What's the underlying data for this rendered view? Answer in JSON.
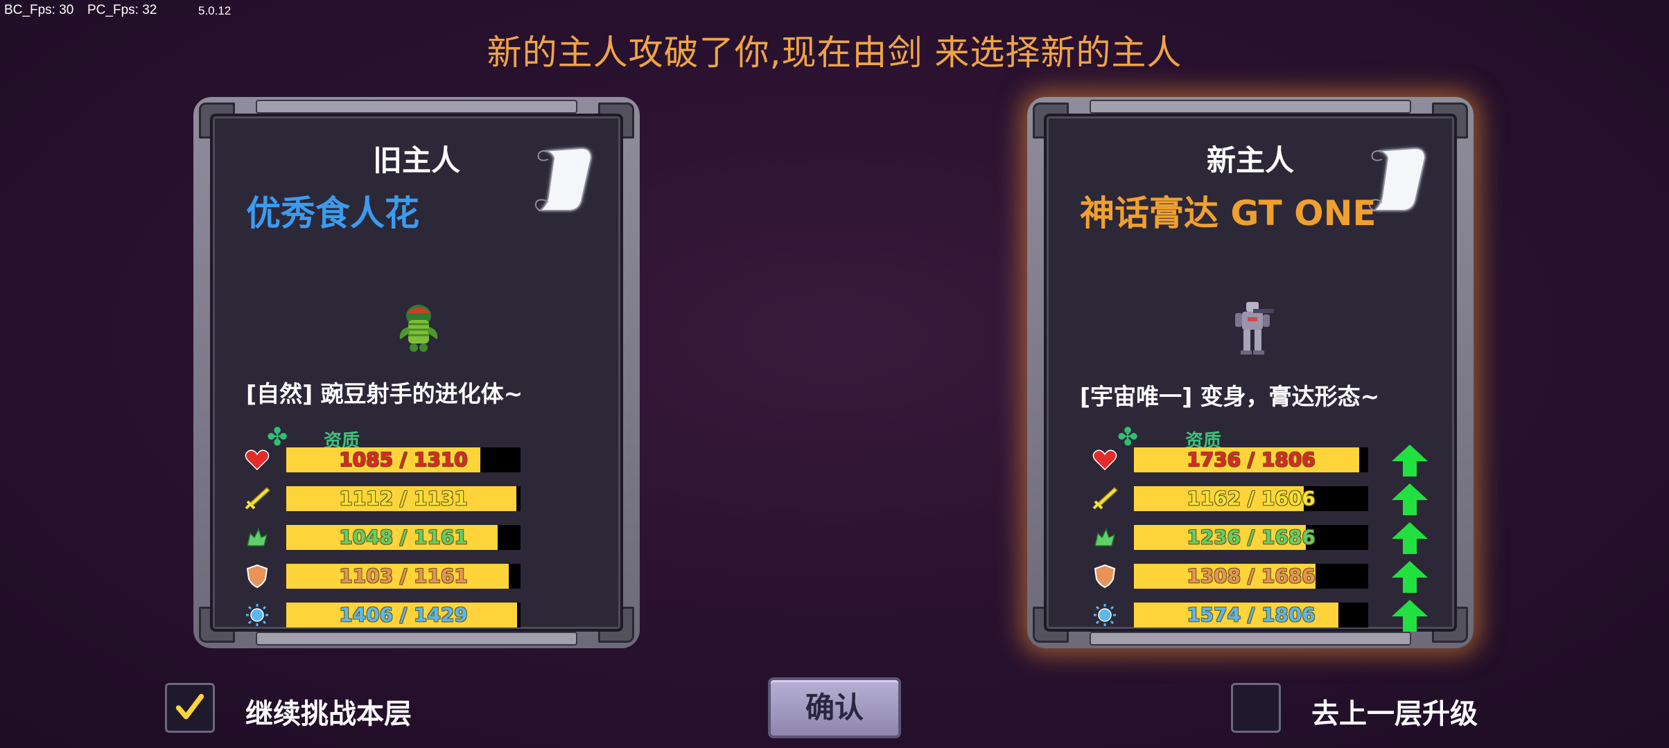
{
  "debug": {
    "bc_fps": "BC_Fps: 30",
    "pc_fps": "PC_Fps: 32",
    "version": "5.0.12"
  },
  "title": "新的主人攻破了你,现在由剑 来选择新的主人",
  "colors": {
    "title": "#f0a445",
    "old_name": "#3b9bf0",
    "new_name": "#f0a030",
    "bar_fill": "#ffd43b",
    "hp_text": "#e0242a",
    "atk_text": "#f2e23a",
    "spd_text": "#5fcf6a",
    "def_text": "#e8935a",
    "mp_text": "#5ab8f0",
    "up_arrow": "#22e040"
  },
  "old_owner": {
    "heading": "旧主人",
    "name": "优秀食人花",
    "desc": "[自然]  豌豆射手的进化体~",
    "quality_label": "资质",
    "stats": [
      {
        "icon": "heart-icon",
        "text": "1085 / 1310",
        "fill": 0.828
      },
      {
        "icon": "sword-icon",
        "text": "1112 / 1131",
        "fill": 0.983
      },
      {
        "icon": "boot-icon",
        "text": "1048 / 1161",
        "fill": 0.903
      },
      {
        "icon": "shield-icon",
        "text": "1103 / 1161",
        "fill": 0.95
      },
      {
        "icon": "sun-icon",
        "text": "1406 / 1429",
        "fill": 0.984
      }
    ]
  },
  "new_owner": {
    "heading": "新主人",
    "name": "神话膏达 GT ONE",
    "desc": "[宇宙唯一] 变身，膏达形态~",
    "quality_label": "资质",
    "stats": [
      {
        "icon": "heart-icon",
        "text": "1736 / 1806",
        "fill": 0.961
      },
      {
        "icon": "sword-icon",
        "text": "1162 / 1606",
        "fill": 0.724
      },
      {
        "icon": "boot-icon",
        "text": "1236 / 1686",
        "fill": 0.733
      },
      {
        "icon": "shield-icon",
        "text": "1308 / 1686",
        "fill": 0.776
      },
      {
        "icon": "sun-icon",
        "text": "1574 / 1806",
        "fill": 0.872
      }
    ]
  },
  "continue_checkbox": {
    "label": "继续挑战本层",
    "checked": true
  },
  "confirm_button": {
    "label": "确认"
  },
  "upgrade_checkbox": {
    "label": "去上一层升级",
    "checked": false
  }
}
